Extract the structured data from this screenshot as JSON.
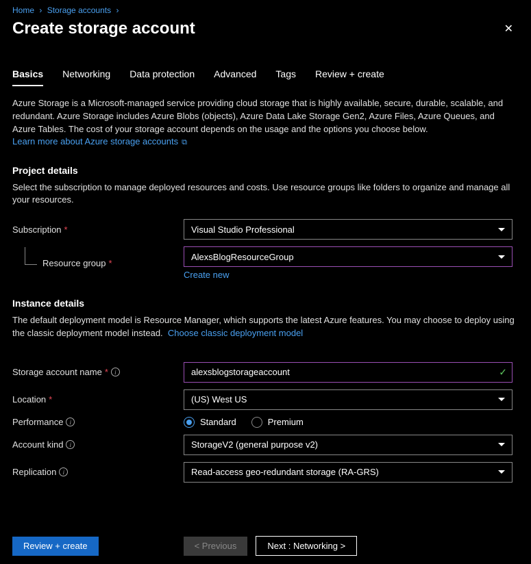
{
  "breadcrumb": {
    "home": "Home",
    "storage": "Storage accounts"
  },
  "header": {
    "title": "Create storage account"
  },
  "tabs": {
    "basics": "Basics",
    "networking": "Networking",
    "data_protection": "Data protection",
    "advanced": "Advanced",
    "tags": "Tags",
    "review": "Review + create"
  },
  "intro": {
    "text": "Azure Storage is a Microsoft-managed service providing cloud storage that is highly available, secure, durable, scalable, and redundant. Azure Storage includes Azure Blobs (objects), Azure Data Lake Storage Gen2, Azure Files, Azure Queues, and Azure Tables. The cost of your storage account depends on the usage and the options you choose below.",
    "link": "Learn more about Azure storage accounts"
  },
  "project": {
    "title": "Project details",
    "desc": "Select the subscription to manage deployed resources and costs. Use resource groups like folders to organize and manage all your resources.",
    "subscription_label": "Subscription",
    "subscription_value": "Visual Studio Professional",
    "rg_label": "Resource group",
    "rg_value": "AlexsBlogResourceGroup",
    "create_new": "Create new"
  },
  "instance": {
    "title": "Instance details",
    "desc_prefix": "The default deployment model is Resource Manager, which supports the latest Azure features. You may choose to deploy using the classic deployment model instead.",
    "classic_link": "Choose classic deployment model",
    "name_label": "Storage account name",
    "name_value": "alexsblogstorageaccount",
    "location_label": "Location",
    "location_value": "(US) West US",
    "performance_label": "Performance",
    "perf_standard": "Standard",
    "perf_premium": "Premium",
    "kind_label": "Account kind",
    "kind_value": "StorageV2 (general purpose v2)",
    "replication_label": "Replication",
    "replication_value": "Read-access geo-redundant storage (RA-GRS)"
  },
  "footer": {
    "review": "Review + create",
    "previous": "< Previous",
    "next": "Next : Networking >"
  }
}
